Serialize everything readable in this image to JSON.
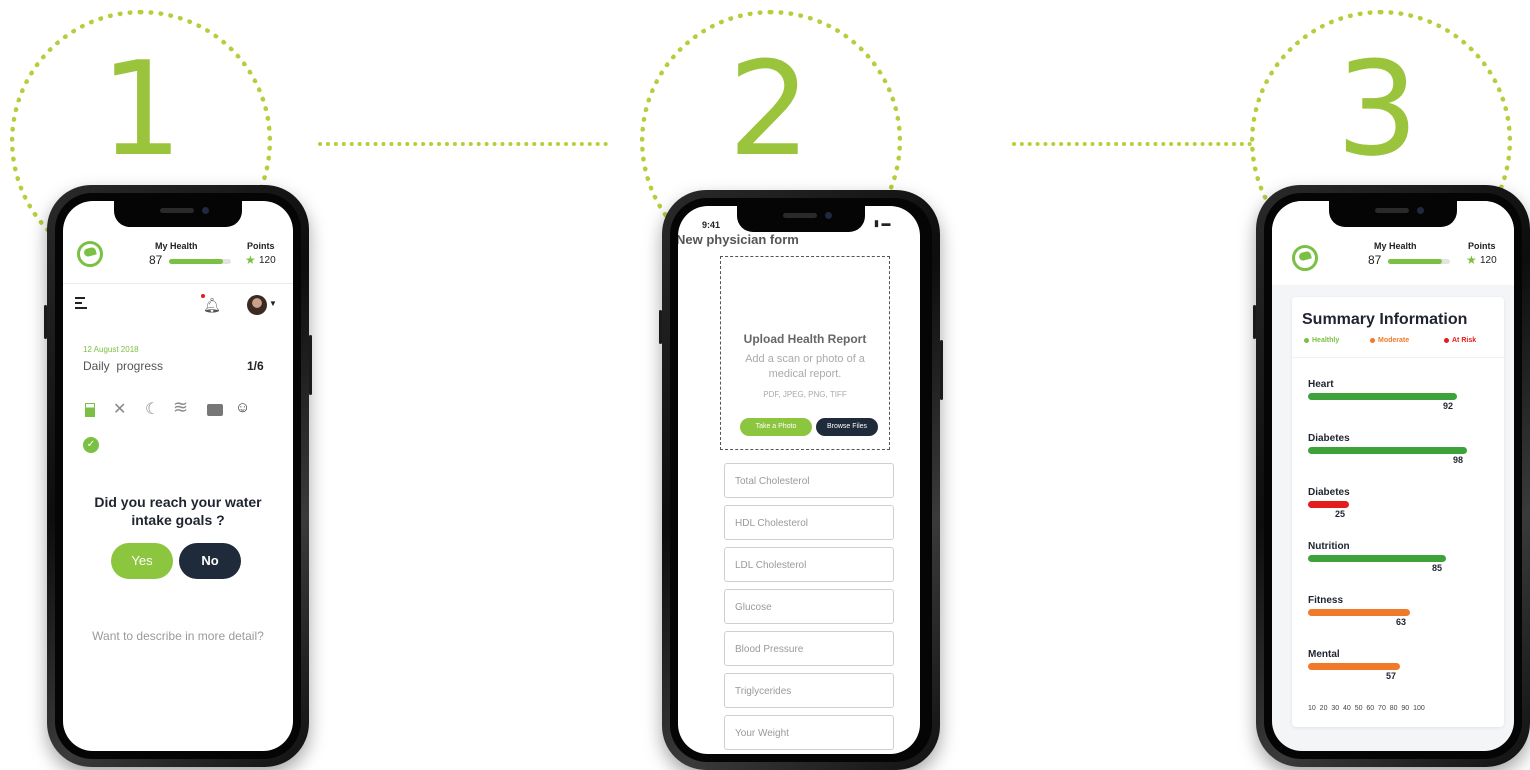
{
  "steps": [
    {
      "number": "1"
    },
    {
      "number": "2"
    },
    {
      "number": "3"
    }
  ],
  "screen1": {
    "header": {
      "my_health_label": "My Health",
      "health_score": "87",
      "health_progress": 0.87,
      "points_label": "Points",
      "points": "120"
    },
    "date": "12 August 2018",
    "progress_label": "Daily  progress",
    "progress_count": "1/6",
    "icons": [
      "water-icon",
      "food-icon",
      "sleep-icon",
      "exercise-icon",
      "work-icon",
      "mood-icon"
    ],
    "question": "Did you reach your water intake goals ?",
    "yes_label": "Yes",
    "no_label": "No",
    "detail_link": "Want to describe in more detail?"
  },
  "screen2": {
    "status_time": "9:41",
    "title": "New physician form",
    "upload_title": "Upload Health Report",
    "upload_hint": "Add a scan or photo of a medical report.",
    "formats": "PDF, JPEG, PNG, TIFF",
    "take_photo_label": "Take a Photo",
    "browse_label": "Browse Files",
    "fields": [
      "Total Cholesterol",
      "HDL Cholesterol",
      "LDL Cholesterol",
      "Glucose",
      "Blood Pressure",
      "Triglycerides",
      "Your Weight"
    ]
  },
  "screen3": {
    "header": {
      "my_health_label": "My Health",
      "health_score": "87",
      "health_progress": 0.87,
      "points_label": "Points",
      "points": "120"
    },
    "title": "Summary Information",
    "legend": [
      {
        "label": "Healthly",
        "color": "#7ac143"
      },
      {
        "label": "Moderate",
        "color": "#f07a2a"
      },
      {
        "label": "At Risk",
        "color": "#e41c1c"
      }
    ],
    "metrics": [
      {
        "label": "Heart",
        "value": 92,
        "color": "#3ea23a"
      },
      {
        "label": "Diabetes",
        "value": 98,
        "color": "#3ea23a"
      },
      {
        "label": "Diabetes",
        "value": 25,
        "color": "#e41c1c"
      },
      {
        "label": "Nutrition",
        "value": 85,
        "color": "#3ea23a"
      },
      {
        "label": "Fitness",
        "value": 63,
        "color": "#f07a2a"
      },
      {
        "label": "Mental",
        "value": 57,
        "color": "#f07a2a"
      }
    ],
    "axis_ticks": "10  20  30  40  50  60  70  80  90  100"
  },
  "colors": {
    "accent": "#7ac143",
    "dark_button": "#1f2b3a",
    "dotted": "#b5cf3c"
  }
}
